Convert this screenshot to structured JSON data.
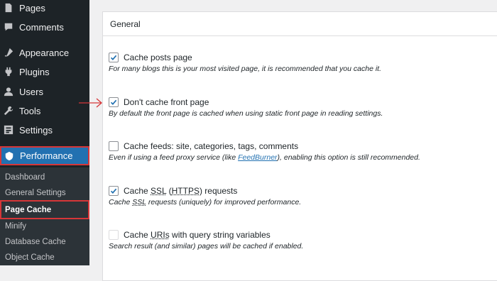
{
  "sidebar": {
    "items": [
      {
        "label": "Pages",
        "icon": "pages-icon"
      },
      {
        "label": "Comments",
        "icon": "comments-icon"
      },
      {
        "label": "Appearance",
        "icon": "appearance-icon"
      },
      {
        "label": "Plugins",
        "icon": "plugins-icon"
      },
      {
        "label": "Users",
        "icon": "users-icon"
      },
      {
        "label": "Tools",
        "icon": "tools-icon"
      },
      {
        "label": "Settings",
        "icon": "settings-icon"
      }
    ],
    "active": {
      "label": "Performance",
      "icon": "performance-icon"
    },
    "submenu": [
      "Dashboard",
      "General Settings",
      "Page Cache",
      "Minify",
      "Database Cache",
      "Object Cache"
    ],
    "current_submenu": "Page Cache"
  },
  "panel": {
    "title": "General",
    "options": [
      {
        "label": "Cache posts page",
        "checked": true,
        "desc": "For many blogs this is your most visited page, it is recommended that you cache it."
      },
      {
        "label": "Don't cache front page",
        "checked": true,
        "desc": "By default the front page is cached when using static front page in reading settings."
      },
      {
        "label": "Cache feeds: site, categories, tags, comments",
        "checked": false,
        "desc_before": "Even if using a feed proxy service (like ",
        "desc_link": "FeedBurner",
        "desc_after": "), enabling this option is still recommended."
      },
      {
        "label_a": "Cache ",
        "label_b": "SSL",
        "label_c": " (",
        "label_d": "HTTPS",
        "label_e": ") requests",
        "checked": true,
        "desc_a": "Cache ",
        "desc_b": "SSL",
        "desc_c": " requests (uniquely) for improved performance."
      },
      {
        "label_a": "Cache ",
        "label_b": "URIs",
        "label_c": " with query string variables",
        "checked": false,
        "disabled": true,
        "desc": "Search result (and similar) pages will be cached if enabled."
      }
    ]
  },
  "colors": {
    "accent": "#2271b1",
    "highlight": "#d63638",
    "sidebar": "#1d2327"
  }
}
